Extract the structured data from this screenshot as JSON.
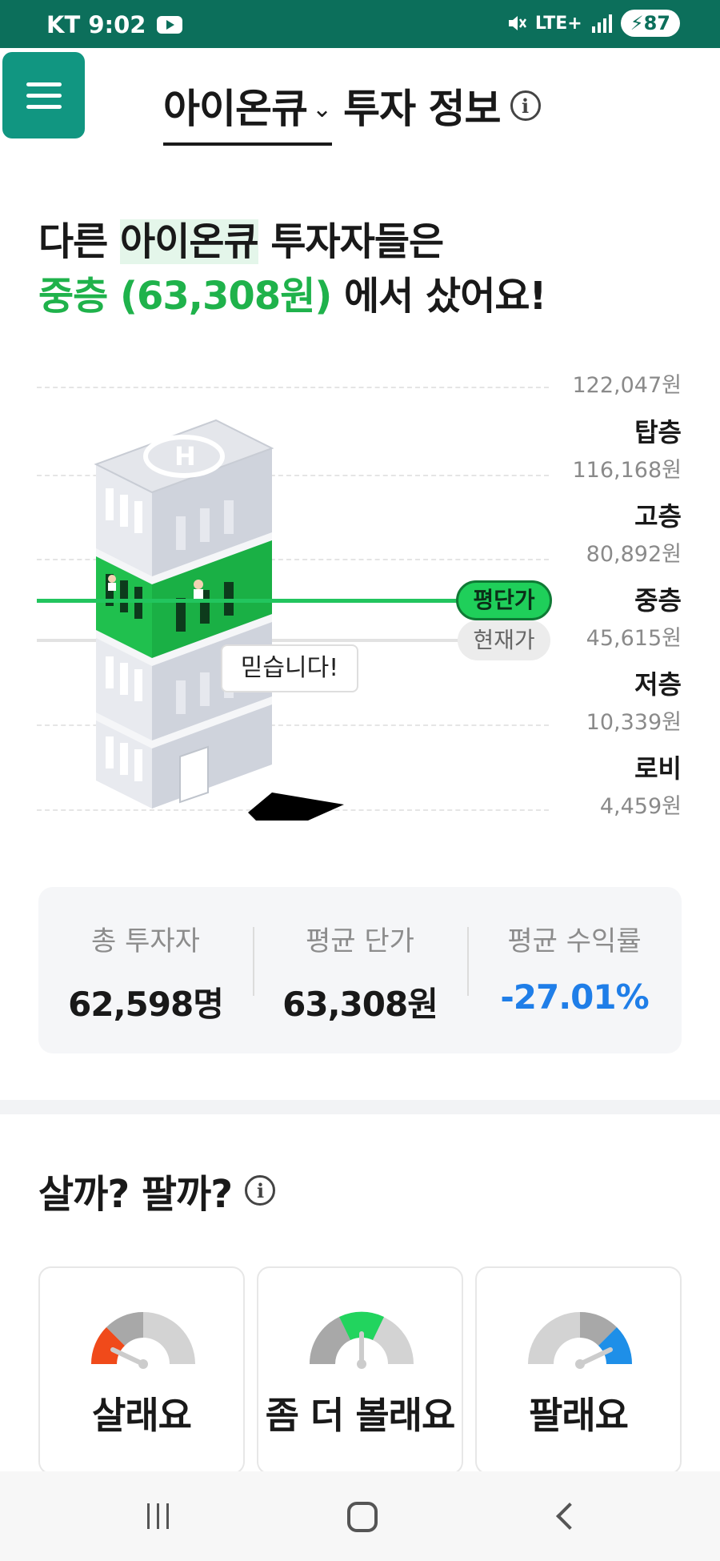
{
  "status_bar": {
    "carrier_time": "KT 9:02",
    "network": "LTE+",
    "battery": "87"
  },
  "header": {
    "stock_name": "아이온큐",
    "title": "투자 정보",
    "info_glyph": "i"
  },
  "headline": {
    "line1_prefix": "다른 ",
    "line1_stock": "아이온큐",
    "line1_suffix": " 투자자들은",
    "line2_highlight": "중층 (63,308원)",
    "line2_suffix": " 에서 샀어요!"
  },
  "building_chart": {
    "top_price": "122,047원",
    "floors": [
      {
        "name": "탑층",
        "price": "116,168원"
      },
      {
        "name": "고층",
        "price": "80,892원"
      },
      {
        "name": "중층",
        "price": "45,615원"
      },
      {
        "name": "저층",
        "price": "10,339원"
      },
      {
        "name": "로비",
        "price": "4,459원"
      }
    ],
    "avg_label": "평단가",
    "current_label": "현재가",
    "speech_bubble": "믿습니다!"
  },
  "stats": [
    {
      "label": "총 투자자",
      "value": "62,598명"
    },
    {
      "label": "평균 단가",
      "value": "63,308원"
    },
    {
      "label": "평균 수익률",
      "value": "-27.01%"
    }
  ],
  "buy_sell": {
    "title": "살까? 팔까?",
    "options": [
      {
        "label": "살래요",
        "color": "#f04a1a"
      },
      {
        "label": "좀 더 볼래요",
        "color": "#22d45e"
      },
      {
        "label": "팔래요",
        "color": "#1e8fe8"
      }
    ]
  },
  "colors": {
    "brand": "#119681",
    "status_bar": "#0c6f5b",
    "accent_green": "#1fb24b",
    "negative_blue": "#1f7ee8"
  },
  "icons": [
    "menu-icon",
    "chevron-down-icon",
    "info-icon",
    "mute-icon",
    "signal-icon",
    "battery-icon",
    "youtube-icon",
    "recents-icon",
    "home-icon",
    "back-icon"
  ]
}
